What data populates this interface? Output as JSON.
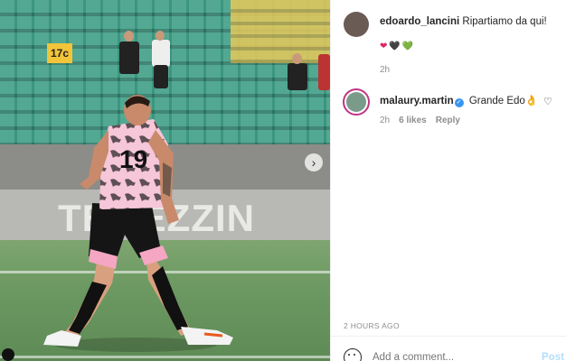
{
  "photo": {
    "seat_sign": "17c",
    "banner_text": "TEMEZZIN",
    "jersey_number": "19"
  },
  "post": {
    "author": "edoardo_lancini",
    "caption": "Ripartiamo da qui!",
    "caption_emojis": [
      "❤",
      "🖤",
      "💚"
    ],
    "caption_time": "2h",
    "posted_time": "2 HOURS AGO"
  },
  "comments": [
    {
      "username": "malaury.martin",
      "verified": true,
      "text": "Grande Edo👌",
      "time": "2h",
      "likes": "6 likes",
      "reply_label": "Reply"
    }
  ],
  "composer": {
    "placeholder": "Add a comment...",
    "post_label": "Post"
  },
  "icons": {
    "next": "chevron-right-icon",
    "like": "heart-outline-icon",
    "emoji": "smiley-icon",
    "tag": "user-tag-icon"
  },
  "colors": {
    "verified": "#3897f0",
    "post_disabled": "#b2dffc",
    "muted_text": "#8e8e8e"
  }
}
